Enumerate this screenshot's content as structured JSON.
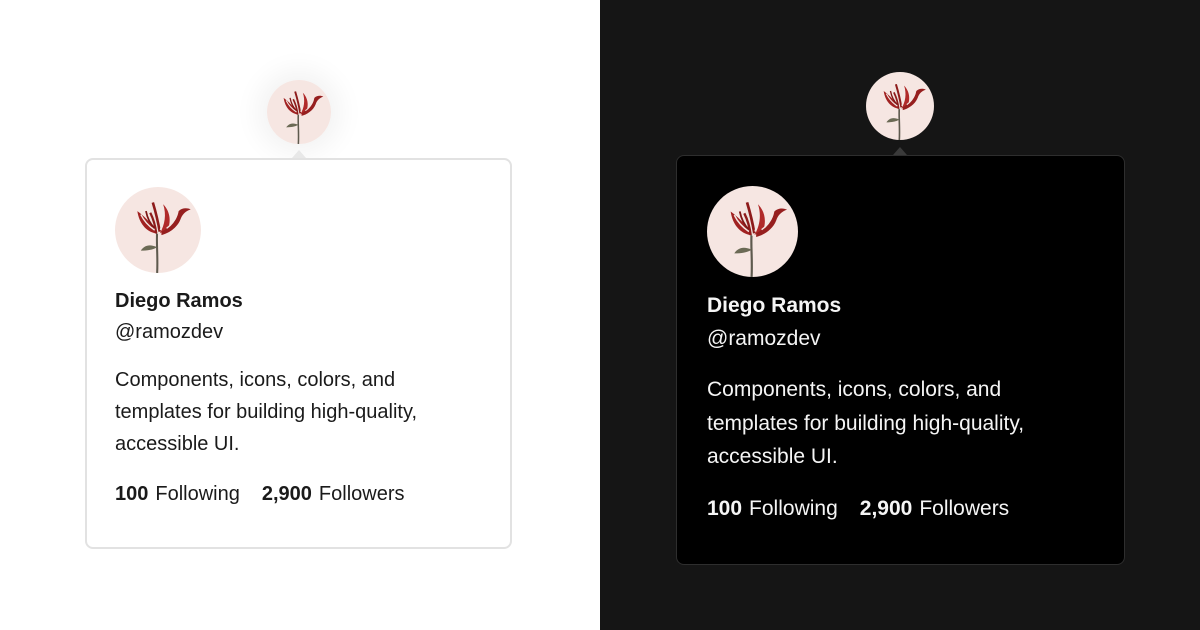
{
  "hovercards": [
    {
      "theme": "light",
      "name": "Diego Ramos",
      "handle": "@ramozdev",
      "bio": "Components, icons, colors, and templates for building high-quality, accessible UI.",
      "following_count": "100",
      "following_label": "Following",
      "followers_count": "2,900",
      "followers_label": "Followers"
    },
    {
      "theme": "dark",
      "name": "Diego Ramos",
      "handle": "@ramozdev",
      "bio": "Components, icons, colors, and templates for building high-quality, accessible UI.",
      "following_count": "100",
      "following_label": "Following",
      "followers_count": "2,900",
      "followers_label": "Followers"
    }
  ],
  "colors": {
    "light_bg": "#ffffff",
    "dark_bg": "#151515",
    "dark_card_bg": "#000000",
    "avatar_bg": "#f6e6e2",
    "tulip_red": "#8e1b1b"
  },
  "avatar_image": "tulip-illustration"
}
